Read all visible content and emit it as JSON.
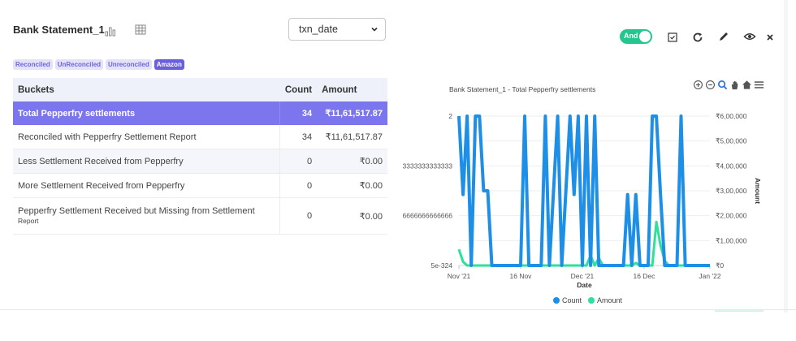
{
  "header": {
    "title": "Bank Statement_1",
    "chart_icon": "bar-chart-icon",
    "table_icon": "grid-table-icon"
  },
  "date_select": {
    "value": "txn_date"
  },
  "tags": [
    {
      "label": "Reconciled"
    },
    {
      "label": "UnReconciled"
    },
    {
      "label": "Unreconciled"
    },
    {
      "label": "Amazon",
      "active": true
    }
  ],
  "table": {
    "headers": {
      "buckets": "Buckets",
      "count": "Count",
      "amount": "Amount"
    },
    "rows": [
      {
        "label": "Total Pepperfry settlements",
        "count": "34",
        "amount": "₹11,61,517.87",
        "selected": true
      },
      {
        "label": "Reconciled with Pepperfry Settlement Report",
        "count": "34",
        "amount": "₹11,61,517.87"
      },
      {
        "label": "Less Settlement Received from Pepperfry",
        "count": "0",
        "amount": "₹0.00"
      },
      {
        "label": "More Settlement Received from  Pepperfry",
        "count": "0",
        "amount": "₹0.00"
      },
      {
        "label": "Pepperfry Settlement Received but Missing from Settlement",
        "label_sub": "Report",
        "count": "0",
        "amount": "₹0.00"
      }
    ]
  },
  "toolbar": {
    "toggle_label": "And",
    "toggle_on": true,
    "icons": [
      "checkbox-icon",
      "refresh-icon",
      "edit-icon",
      "eye-icon",
      "close-icon"
    ]
  },
  "chart_tools": [
    "zoom-in-icon",
    "zoom-out-icon",
    "zoom-select-icon",
    "pan-hand-icon",
    "home-icon",
    "menu-icon"
  ],
  "colors": {
    "count": "#1e8fe6",
    "amount": "#2ee09a",
    "accent": "#7b75ee",
    "toggle": "#22c68e"
  },
  "chart_data": {
    "type": "line",
    "title": "Bank Statement_1 - Total Pepperfry settlements",
    "xlabel": "Date",
    "x_ticks": [
      "Nov '21",
      "16 Nov",
      "Dec '21",
      "16 Dec",
      "Jan '22"
    ],
    "y_left_ticks": [
      "2",
      "3333333333333",
      "6666666666666",
      "5e-324"
    ],
    "ylabel_right": "Amount",
    "y_right_ticks": [
      "₹6,00,000",
      "₹5,00,000",
      "₹4,00,000",
      "₹3,00,000",
      "₹2,00,000",
      "₹1,00,000",
      "₹0"
    ],
    "ylim_left": [
      0,
      2
    ],
    "ylim_right": [
      0,
      600000
    ],
    "x_range": [
      "2021-11-01",
      "2022-01-01"
    ],
    "legend_position": "bottom",
    "series": [
      {
        "name": "Count",
        "axis": "left",
        "points": [
          [
            "2021-11-01",
            2
          ],
          [
            "2021-11-02",
            0.95
          ],
          [
            "2021-11-03",
            2
          ],
          [
            "2021-11-04",
            0
          ],
          [
            "2021-11-05",
            2
          ],
          [
            "2021-11-06",
            2
          ],
          [
            "2021-11-07",
            1.0
          ],
          [
            "2021-11-08",
            1.0
          ],
          [
            "2021-11-09",
            0
          ],
          [
            "2021-11-16",
            0
          ],
          [
            "2021-11-17",
            2
          ],
          [
            "2021-11-18",
            0
          ],
          [
            "2021-11-21",
            0
          ],
          [
            "2021-11-22",
            2
          ],
          [
            "2021-11-23",
            0
          ],
          [
            "2021-11-25",
            2
          ],
          [
            "2021-11-26",
            0
          ],
          [
            "2021-11-28",
            2
          ],
          [
            "2021-11-29",
            0.95
          ],
          [
            "2021-11-30",
            2
          ],
          [
            "2021-12-01",
            0
          ],
          [
            "2021-12-02",
            2
          ],
          [
            "2021-12-03",
            0
          ],
          [
            "2021-12-04",
            2
          ],
          [
            "2021-12-05",
            0
          ],
          [
            "2021-12-11",
            0
          ],
          [
            "2021-12-12",
            0.95
          ],
          [
            "2021-12-13",
            0
          ],
          [
            "2021-12-14",
            0.95
          ],
          [
            "2021-12-15",
            0
          ],
          [
            "2021-12-17",
            0
          ],
          [
            "2021-12-18",
            2
          ],
          [
            "2021-12-19",
            2
          ],
          [
            "2021-12-20",
            0.95
          ],
          [
            "2021-12-21",
            0
          ],
          [
            "2021-12-24",
            0
          ],
          [
            "2021-12-25",
            2
          ],
          [
            "2021-12-26",
            0
          ],
          [
            "2022-01-01",
            0
          ]
        ]
      },
      {
        "name": "Amount",
        "axis": "right",
        "points": [
          [
            "2021-11-01",
            65000
          ],
          [
            "2021-11-02",
            15000
          ],
          [
            "2021-11-03",
            0
          ],
          [
            "2021-11-05",
            0
          ],
          [
            "2021-11-09",
            0
          ],
          [
            "2021-11-16",
            0
          ],
          [
            "2021-11-17",
            0
          ],
          [
            "2021-11-25",
            0
          ],
          [
            "2021-12-02",
            0
          ],
          [
            "2021-12-03",
            40000
          ],
          [
            "2021-12-04",
            0
          ],
          [
            "2021-12-05",
            30000
          ],
          [
            "2021-12-06",
            0
          ],
          [
            "2021-12-13",
            0
          ],
          [
            "2021-12-14",
            10000
          ],
          [
            "2021-12-15",
            0
          ],
          [
            "2021-12-18",
            0
          ],
          [
            "2021-12-19",
            175000
          ],
          [
            "2021-12-20",
            80000
          ],
          [
            "2021-12-21",
            20000
          ],
          [
            "2021-12-22",
            0
          ],
          [
            "2022-01-01",
            0
          ]
        ]
      }
    ]
  }
}
